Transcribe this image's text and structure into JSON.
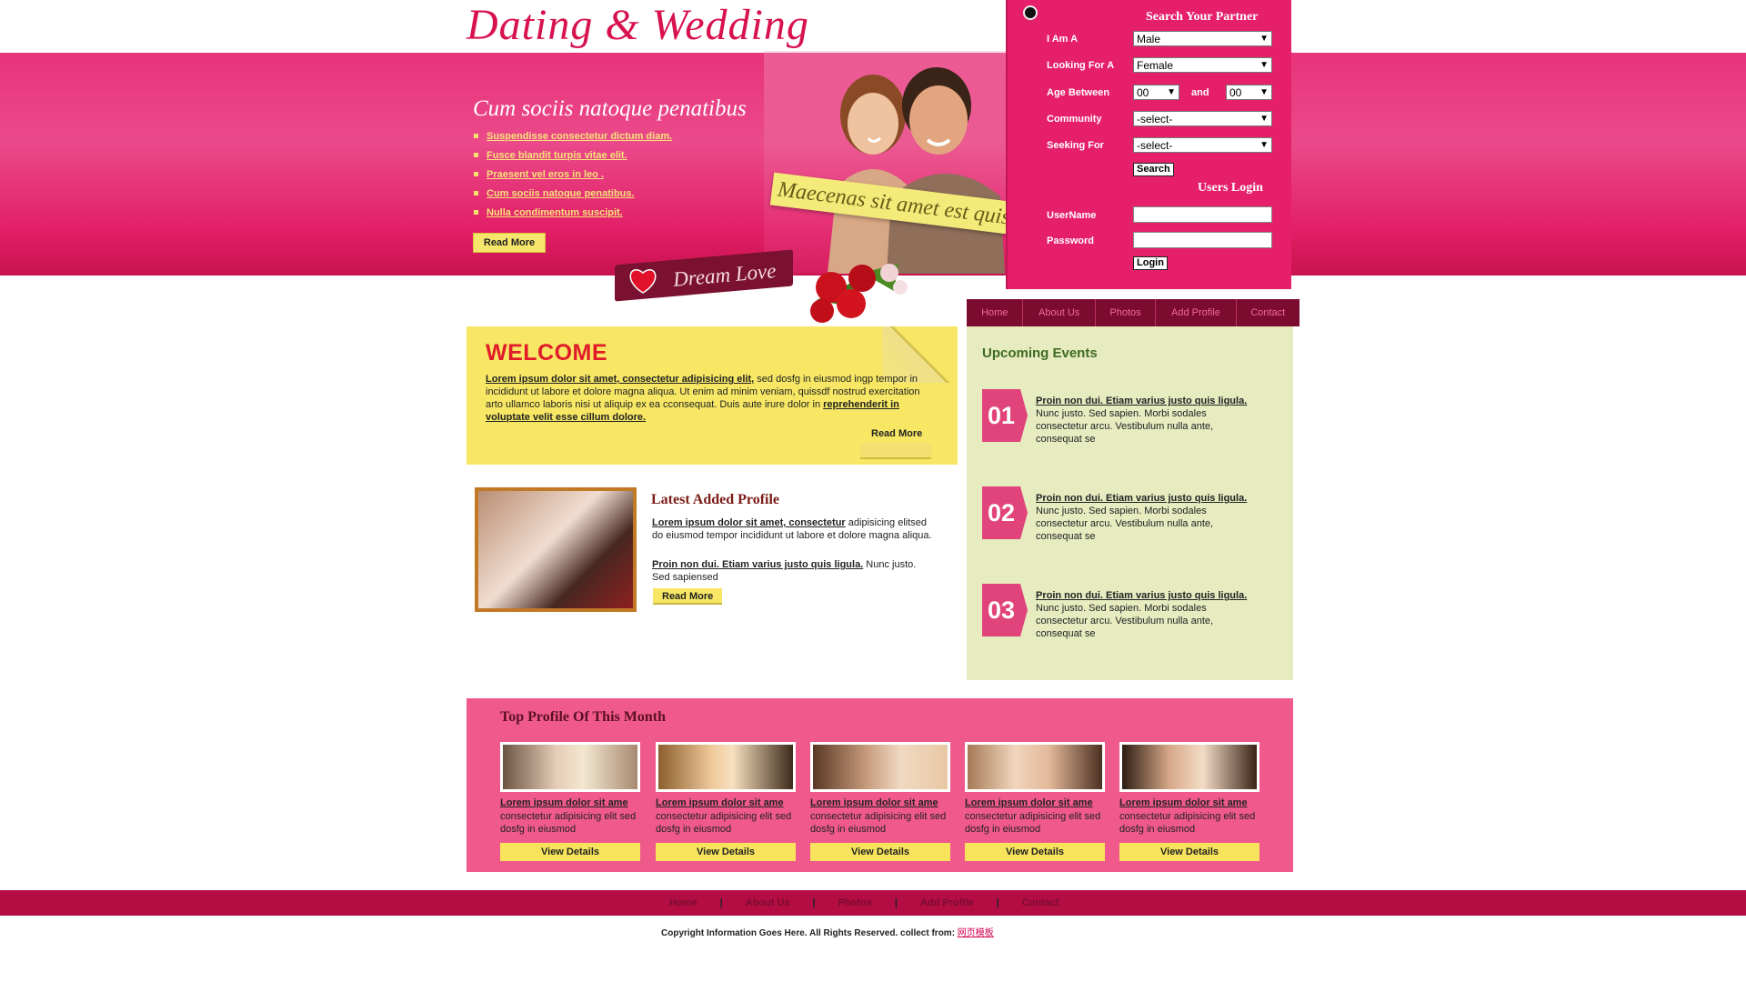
{
  "brand": {
    "logo": "Dating & Wedding",
    "accent": "#e51f6a",
    "yellow": "#f7e765"
  },
  "hero": {
    "heading": "Cum sociis natoque penatibus",
    "items": [
      "Suspendisse consectetur dictum diam.",
      "Fusce blandit turpis vitae elit.",
      "Praesent vel eros in leo .",
      "Cum sociis natoque penatibus.",
      "Nulla condimentum suscipit."
    ],
    "read_more": "Read More",
    "sticky_note": "Maecenas sit amet est quis",
    "badge": "Dream Love"
  },
  "search": {
    "title": "Search Your Partner",
    "i_am_a_label": "I Am A",
    "i_am_a_value": "Male",
    "looking_for_label": "Looking For A",
    "looking_for_value": "Female",
    "age_label": "Age Between",
    "age_from": "00",
    "age_and": "and",
    "age_to": "00",
    "community_label": "Community",
    "community_value": "-select-",
    "seeking_label": "Seeking For",
    "seeking_value": "-select-",
    "search_button": "Search"
  },
  "login": {
    "title": "Users Login",
    "username_label": "UserName",
    "password_label": "Password",
    "login_button": "Login"
  },
  "nav": [
    "Home",
    "About Us",
    "Photos",
    "Add Profile",
    "Contact"
  ],
  "welcome": {
    "title": "WELCOME",
    "lead_link": "Lorem ipsum dolor sit amet, consectetur adipisicing elit,",
    "body": " sed dosfg in eiusmod ingp tempor in incididunt ut labore et dolore magna aliqua. Ut enim ad minim veniam, quissdf nostrud exercitation arto ullamco laboris nisi ut aliquip ex ea cconsequat. Duis aute irure dolor in ",
    "tail_link": "reprehenderit in voluptate velit esse cillum dolore.",
    "read_more": "Read More"
  },
  "latest_profile": {
    "title": "Latest Added Profile",
    "link1": "Lorem ipsum dolor sit amet, consectetur",
    "text1": " adipisicing elitsed do eiusmod tempor incididunt ut labore et dolore magna aliqua.",
    "link2": "Proin non dui. Etiam varius justo quis ligula.",
    "text2": " Nunc justo. Sed sapiensed",
    "read_more": "Read More"
  },
  "events": {
    "title": "Upcoming Events",
    "items": [
      {
        "num": "01",
        "title": "Proin non dui. Etiam varius justo quis ligula.",
        "text": "Nunc justo. Sed sapien. Morbi sodales consectetur arcu. Vestibulum nulla ante, consequat se"
      },
      {
        "num": "02",
        "title": "Proin non dui. Etiam varius justo quis ligula.",
        "text": "Nunc justo. Sed sapien. Morbi sodales consectetur arcu. Vestibulum nulla ante, consequat se"
      },
      {
        "num": "03",
        "title": "Proin non dui. Etiam varius justo quis ligula.",
        "text": "Nunc justo. Sed sapien. Morbi sodales consectetur arcu. Vestibulum nulla ante, consequat se"
      }
    ]
  },
  "top_profiles": {
    "title": "Top Profile Of This Month",
    "items": [
      {
        "title": "Lorem ipsum dolor sit ame",
        "desc": "consectetur adipisicing elit sed dosfg in eiusmod",
        "button": "View Details"
      },
      {
        "title": "Lorem ipsum dolor sit ame",
        "desc": "consectetur adipisicing elit sed dosfg in eiusmod",
        "button": "View Details"
      },
      {
        "title": "Lorem ipsum dolor sit ame",
        "desc": "consectetur adipisicing elit sed dosfg in eiusmod",
        "button": "View Details"
      },
      {
        "title": "Lorem ipsum dolor sit ame",
        "desc": "consectetur adipisicing elit sed dosfg in eiusmod",
        "button": "View Details"
      },
      {
        "title": "Lorem ipsum dolor sit ame",
        "desc": "consectetur adipisicing elit sed dosfg in eiusmod",
        "button": "View Details"
      }
    ]
  },
  "footer": {
    "nav": [
      "Home",
      "About Us",
      "Photos",
      "Add Profile",
      "Contact"
    ],
    "copyright": "Copyright Information Goes Here. All Rights Reserved. collect from: ",
    "copyright_link": "网页模板"
  }
}
